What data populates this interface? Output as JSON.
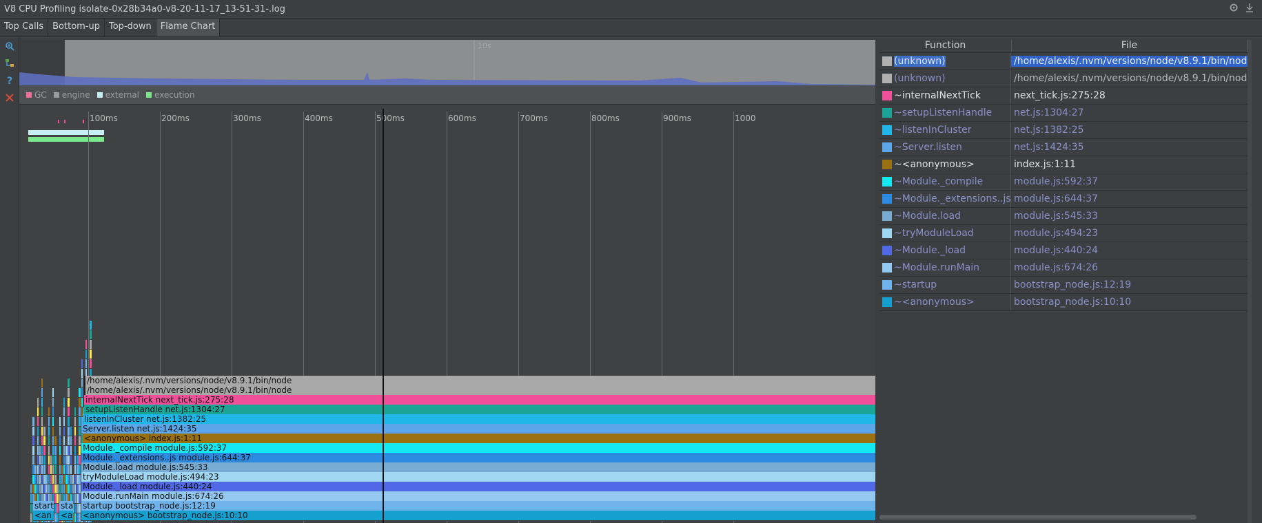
{
  "window": {
    "title": "V8 CPU Profiling isolate-0x28b34a0-v8-20-11-17_13-51-31-.log",
    "right_icons": [
      "gear-icon",
      "download-icon"
    ]
  },
  "tabs": [
    {
      "label": "Top Calls",
      "active": false
    },
    {
      "label": "Bottom-up",
      "active": false
    },
    {
      "label": "Top-down",
      "active": false
    },
    {
      "label": "Flame Chart",
      "active": true
    }
  ],
  "toolbar": {
    "icons": [
      "zoom-in-icon",
      "tree-icon",
      "help-icon",
      "close-icon"
    ]
  },
  "overview": {
    "label": "10s"
  },
  "legend": [
    {
      "label": "GC",
      "color": "#f0709a"
    },
    {
      "label": "engine",
      "color": "#9a9a9a"
    },
    {
      "label": "external",
      "color": "#c7eef5"
    },
    {
      "label": "execution",
      "color": "#7ce88c"
    }
  ],
  "timeline": {
    "ticks": [
      "100ms",
      "200ms",
      "300ms",
      "400ms",
      "500ms",
      "600ms",
      "700ms",
      "800ms",
      "900ms",
      "1000"
    ]
  },
  "flame": {
    "rows": [
      {
        "label": "/home/alexis/.nvm/versions/node/v8.9.1/bin/node",
        "color": "#a8a8a8"
      },
      {
        "label": "/home/alexis/.nvm/versions/node/v8.9.1/bin/node",
        "color": "#a8a8a8"
      },
      {
        "label": "internalNextTick next_tick.js:275:28",
        "color": "#f0509a"
      },
      {
        "label": "setupListenHandle net.js:1304:27",
        "color": "#1aa597"
      },
      {
        "label": "listenInCluster net.js:1382:25",
        "color": "#21b6e8"
      },
      {
        "label": "Server.listen net.js:1424:35",
        "color": "#5aa6e8"
      },
      {
        "label": "<anonymous> index.js:1:11",
        "color": "#9a7010"
      },
      {
        "label": "Module._compile module.js:592:37",
        "color": "#14e8f0"
      },
      {
        "label": "Module._extensions..js module.js:644:37",
        "color": "#2c8ae0"
      },
      {
        "label": "Module.load module.js:545:33",
        "color": "#79acd2"
      },
      {
        "label": "tryModuleLoad module.js:494:23",
        "color": "#9fd6f2"
      },
      {
        "label": "Module._load module.js:440:24",
        "color": "#5168e6"
      },
      {
        "label": "Module.runMain module.js:674:26",
        "color": "#93c9f0"
      },
      {
        "label": "startup bootstrap_node.js:12:19",
        "color": "#6fb3ea"
      },
      {
        "label": "<anonymous> bootstrap_node.js:10:10",
        "color": "#16a0d0"
      }
    ],
    "small_labels": [
      "start",
      "sta",
      "<an",
      "<a"
    ]
  },
  "functions_panel": {
    "columns": [
      "Function",
      "File"
    ],
    "rows": [
      {
        "fn": "(unknown)",
        "file": "/home/alexis/.nvm/versions/node/v8.9.1/bin/node",
        "color": "#b0b0b0",
        "selected": true
      },
      {
        "fn": "(unknown)",
        "file": "/home/alexis/.nvm/versions/node/v8.9.1/bin/node",
        "color": "#b0b0b0",
        "selected": false
      },
      {
        "fn": "~internalNextTick",
        "file": "next_tick.js:275:28",
        "color": "#f0509a",
        "selected": false,
        "bright": true
      },
      {
        "fn": "~setupListenHandle",
        "file": "net.js:1304:27",
        "color": "#1aa597",
        "selected": false
      },
      {
        "fn": "~listenInCluster",
        "file": "net.js:1382:25",
        "color": "#21b6e8",
        "selected": false
      },
      {
        "fn": "~Server.listen",
        "file": "net.js:1424:35",
        "color": "#5aa6e8",
        "selected": false
      },
      {
        "fn": "~<anonymous>",
        "file": "index.js:1:11",
        "color": "#9a7010",
        "selected": false,
        "bright": true
      },
      {
        "fn": "~Module._compile",
        "file": "module.js:592:37",
        "color": "#14e8f0",
        "selected": false
      },
      {
        "fn": "~Module._extensions..js",
        "file": "module.js:644:37",
        "color": "#2c8ae0",
        "selected": false
      },
      {
        "fn": "~Module.load",
        "file": "module.js:545:33",
        "color": "#79acd2",
        "selected": false
      },
      {
        "fn": "~tryModuleLoad",
        "file": "module.js:494:23",
        "color": "#9fd6f2",
        "selected": false
      },
      {
        "fn": "~Module._load",
        "file": "module.js:440:24",
        "color": "#5168e6",
        "selected": false
      },
      {
        "fn": "~Module.runMain",
        "file": "module.js:674:26",
        "color": "#93c9f0",
        "selected": false
      },
      {
        "fn": "~startup",
        "file": "bootstrap_node.js:12:19",
        "color": "#6fb3ea",
        "selected": false
      },
      {
        "fn": "~<anonymous>",
        "file": "bootstrap_node.js:10:10",
        "color": "#16a0d0",
        "selected": false
      }
    ]
  }
}
